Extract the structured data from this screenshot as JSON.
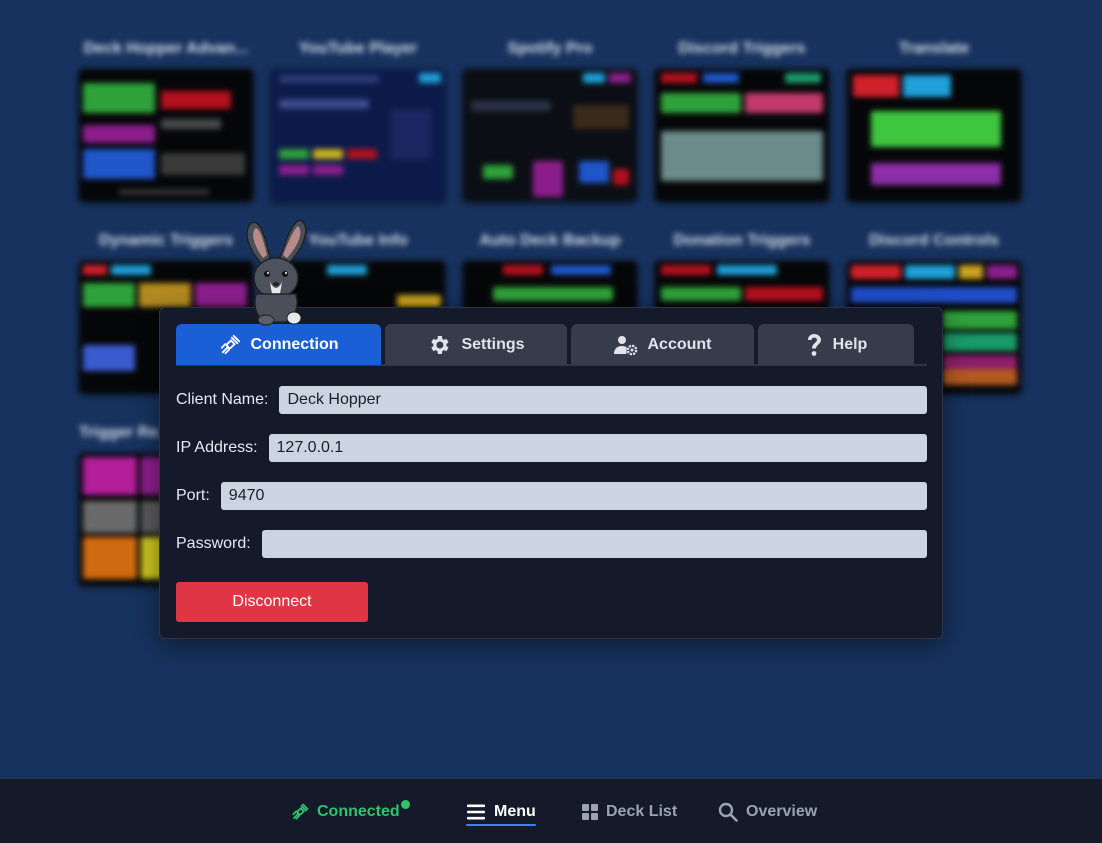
{
  "background": {
    "deck_titles": [
      "Deck Hopper Advan...",
      "YouTube Player",
      "Spotify Pro",
      "Discord Triggers",
      "Translate",
      "Dynamic Triggers",
      "YouTube Info",
      "Auto Deck Backup",
      "Donation Triggers",
      "Discord Controls",
      "Trigger Re..."
    ]
  },
  "dialog": {
    "tabs": [
      {
        "label": "Connection",
        "icon": "plug-icon"
      },
      {
        "label": "Settings",
        "icon": "gear-icon"
      },
      {
        "label": "Account",
        "icon": "user-gear-icon"
      },
      {
        "label": "Help",
        "icon": "question-icon"
      }
    ],
    "active_tab": "Connection",
    "fields": {
      "client_name": {
        "label": "Client Name:",
        "value": "Deck Hopper"
      },
      "ip_address": {
        "label": "IP Address:",
        "value": "127.0.0.1"
      },
      "port": {
        "label": "Port:",
        "value": "9470"
      },
      "password": {
        "label": "Password:",
        "value": ""
      }
    },
    "disconnect_label": "Disconnect"
  },
  "bottom_nav": {
    "connected_label": "Connected",
    "menu_label": "Menu",
    "deck_list_label": "Deck List",
    "overview_label": "Overview"
  },
  "colors": {
    "accent": "#1b5fd6",
    "danger": "#e03545",
    "connected": "#2fc46a",
    "background": "#17325e",
    "panel": "#141a29"
  }
}
